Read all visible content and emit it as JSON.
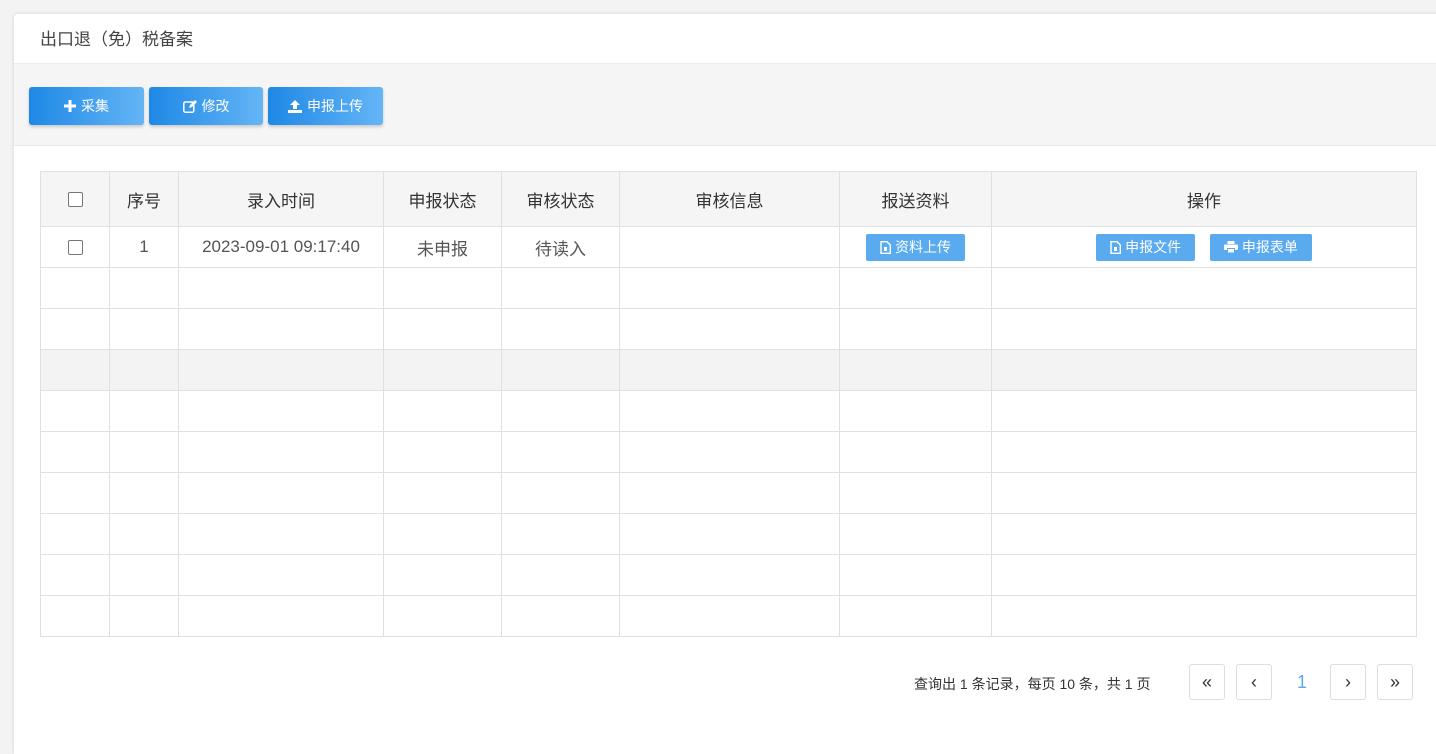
{
  "panel": {
    "title": "出口退（免）税备案"
  },
  "toolbar": {
    "collect_label": "采集",
    "edit_label": "修改",
    "upload_label": "申报上传"
  },
  "table": {
    "columns": [
      "序号",
      "录入时间",
      "申报状态",
      "审核状态",
      "审核信息",
      "报送资料",
      "操作"
    ],
    "rows": [
      {
        "index": "1",
        "time": "2023-09-01 09:17:40",
        "declare_status": "未申报",
        "review_status": "待读入",
        "review_info": "",
        "upload_doc_label": "资料上传",
        "declare_file_label": "申报文件",
        "declare_form_label": "申报表单"
      }
    ]
  },
  "pager": {
    "summary": "查询出 1 条记录，每页 10 条，共 1 页",
    "first": "«",
    "prev": "‹",
    "current": "1",
    "next": "›",
    "last": "»"
  },
  "colors": {
    "primary": "#1e88e5",
    "primary_light": "#5aaaf0"
  },
  "icons": [
    "plus-icon",
    "edit-icon",
    "upload-icon",
    "file-icon",
    "print-icon"
  ]
}
